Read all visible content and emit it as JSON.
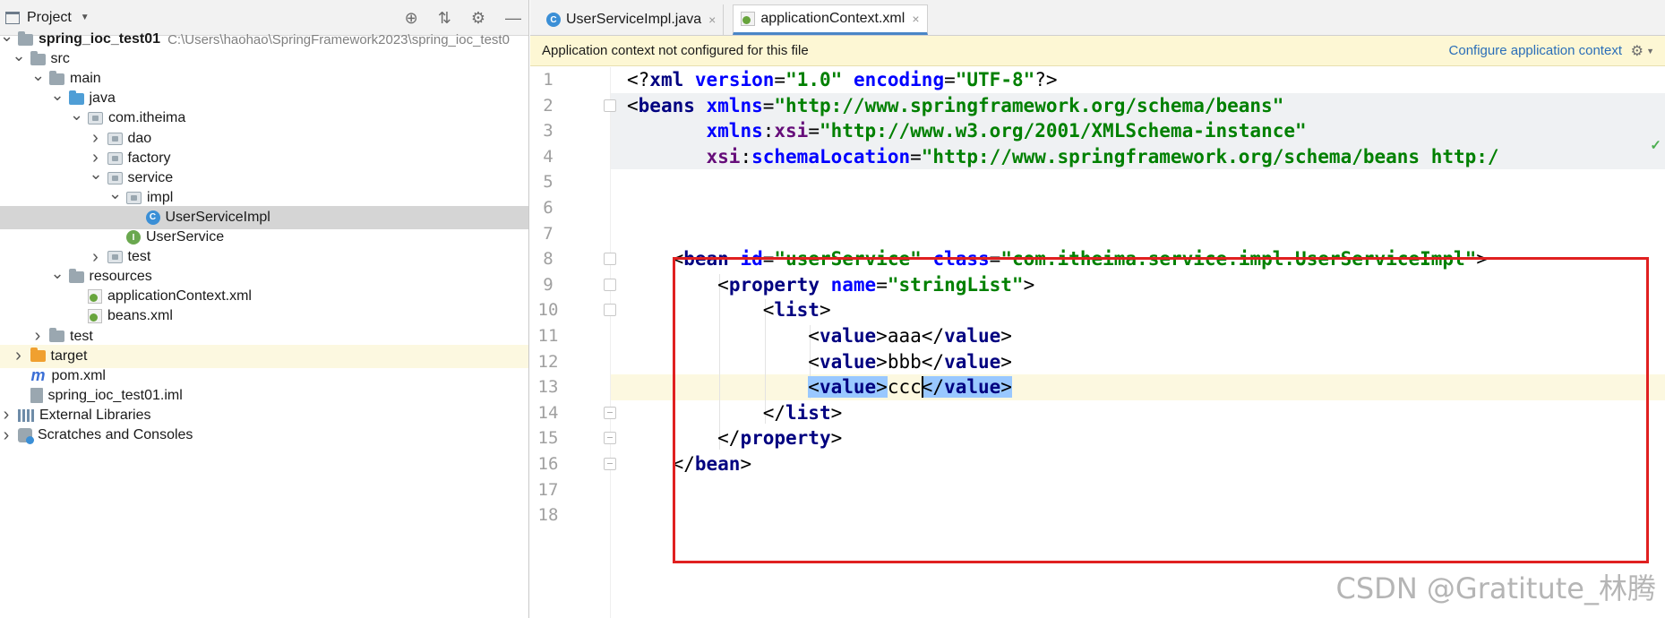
{
  "project_panel": {
    "title": "Project",
    "tools": [
      "target-icon",
      "collapse-icon",
      "gear-icon",
      "minimize-icon"
    ],
    "tree": [
      {
        "label": "spring_ioc_test01",
        "path": "C:\\Users\\haohao\\SpringFramework2023\\spring_ioc_test0",
        "depth": 0,
        "arrow": "v",
        "icon": "folder"
      },
      {
        "label": "src",
        "depth": 1,
        "arrow": "v",
        "icon": "folder"
      },
      {
        "label": "main",
        "depth": 2,
        "arrow": "v",
        "icon": "folder"
      },
      {
        "label": "java",
        "depth": 3,
        "arrow": "v",
        "icon": "folder-blue"
      },
      {
        "label": "com.itheima",
        "depth": 4,
        "arrow": "v",
        "icon": "package"
      },
      {
        "label": "dao",
        "depth": 5,
        "arrow": ">",
        "icon": "package"
      },
      {
        "label": "factory",
        "depth": 5,
        "arrow": ">",
        "icon": "package"
      },
      {
        "label": "service",
        "depth": 5,
        "arrow": "v",
        "icon": "package"
      },
      {
        "label": "impl",
        "depth": 6,
        "arrow": "v",
        "icon": "package"
      },
      {
        "label": "UserServiceImpl",
        "depth": 7,
        "arrow": "",
        "icon": "class"
      },
      {
        "label": "UserService",
        "depth": 6,
        "arrow": "",
        "icon": "interface"
      },
      {
        "label": "test",
        "depth": 5,
        "arrow": ">",
        "icon": "package"
      },
      {
        "label": "resources",
        "depth": 3,
        "arrow": "v",
        "icon": "folder-res"
      },
      {
        "label": "applicationContext.xml",
        "depth": 4,
        "arrow": "",
        "icon": "xml"
      },
      {
        "label": "beans.xml",
        "depth": 4,
        "arrow": "",
        "icon": "xml"
      },
      {
        "label": "test",
        "depth": 2,
        "arrow": ">",
        "icon": "folder"
      },
      {
        "label": "target",
        "depth": 1,
        "arrow": ">",
        "icon": "folder-orange"
      },
      {
        "label": "pom.xml",
        "depth": 1,
        "arrow": "",
        "icon": "maven"
      },
      {
        "label": "spring_ioc_test01.iml",
        "depth": 1,
        "arrow": "",
        "icon": "iml"
      },
      {
        "label": "External Libraries",
        "depth": 0,
        "arrow": ">",
        "icon": "library"
      },
      {
        "label": "Scratches and Consoles",
        "depth": 0,
        "arrow": ">",
        "icon": "scratch"
      }
    ],
    "selected_label": "UserServiceImpl"
  },
  "tabs": [
    {
      "label": "UserServiceImpl.java",
      "icon": "class-icon",
      "active": false
    },
    {
      "label": "applicationContext.xml",
      "icon": "xml-file-icon",
      "active": true
    }
  ],
  "notification": {
    "message": "Application context not configured for this file",
    "link": "Configure application context"
  },
  "editor": {
    "line_numbers": [
      "1",
      "2",
      "3",
      "4",
      "5",
      "6",
      "7",
      "8",
      "9",
      "10",
      "11",
      "12",
      "13",
      "14",
      "15",
      "16",
      "17",
      "18"
    ],
    "current_line": 13,
    "code": [
      [
        [
          "<?",
          "t-punct"
        ],
        [
          "xml",
          "t-tag"
        ],
        [
          " ",
          ""
        ],
        [
          "version",
          "t-attr"
        ],
        [
          "=",
          "t-punct"
        ],
        [
          "\"1.0\"",
          "t-str"
        ],
        [
          " ",
          ""
        ],
        [
          "encoding",
          "t-attr"
        ],
        [
          "=",
          "t-punct"
        ],
        [
          "\"UTF-8\"",
          "t-str"
        ],
        [
          "?>",
          "t-punct"
        ]
      ],
      [
        [
          "<",
          "t-punct"
        ],
        [
          "beans",
          "t-tag"
        ],
        [
          " ",
          ""
        ],
        [
          "xmlns",
          "t-attr"
        ],
        [
          "=",
          "t-punct"
        ],
        [
          "\"http://www.springframework.org/schema/beans\"",
          "t-str"
        ]
      ],
      [
        [
          "       ",
          ""
        ],
        [
          "xmlns",
          "t-attr"
        ],
        [
          ":",
          "t-punct"
        ],
        [
          "xsi",
          "t-ns"
        ],
        [
          "=",
          "t-punct"
        ],
        [
          "\"http://www.w3.org/2001/XMLSchema-instance\"",
          "t-str"
        ]
      ],
      [
        [
          "       ",
          ""
        ],
        [
          "xsi",
          "t-ns"
        ],
        [
          ":",
          "t-punct"
        ],
        [
          "schemaLocation",
          "t-attr"
        ],
        [
          "=",
          "t-punct"
        ],
        [
          "\"http://www.springframework.org/schema/beans http:/",
          "t-str"
        ]
      ],
      [],
      [],
      [],
      [
        [
          "    ",
          ""
        ],
        [
          "<",
          "t-punct"
        ],
        [
          "bean",
          "t-tag"
        ],
        [
          " ",
          ""
        ],
        [
          "id",
          "t-attr"
        ],
        [
          "=",
          "t-punct"
        ],
        [
          "\"userService\"",
          "t-str"
        ],
        [
          " ",
          ""
        ],
        [
          "class",
          "t-attr"
        ],
        [
          "=",
          "t-punct"
        ],
        [
          "\"com.itheima.service.impl.UserServiceImpl\"",
          "t-str"
        ],
        [
          ">",
          "t-punct"
        ]
      ],
      [
        [
          "        ",
          ""
        ],
        [
          "<",
          "t-punct"
        ],
        [
          "property",
          "t-tag"
        ],
        [
          " ",
          ""
        ],
        [
          "name",
          "t-attr"
        ],
        [
          "=",
          "t-punct"
        ],
        [
          "\"stringList\"",
          "t-str"
        ],
        [
          ">",
          "t-punct"
        ]
      ],
      [
        [
          "            ",
          ""
        ],
        [
          "<",
          "t-punct"
        ],
        [
          "list",
          "t-tag"
        ],
        [
          ">",
          "t-punct"
        ]
      ],
      [
        [
          "                ",
          ""
        ],
        [
          "<",
          "t-punct"
        ],
        [
          "value",
          "t-tag"
        ],
        [
          ">",
          "t-punct"
        ],
        [
          "aaa",
          "t-text"
        ],
        [
          "</",
          "t-punct"
        ],
        [
          "value",
          "t-tag"
        ],
        [
          ">",
          "t-punct"
        ]
      ],
      [
        [
          "                ",
          ""
        ],
        [
          "<",
          "t-punct"
        ],
        [
          "value",
          "t-tag"
        ],
        [
          ">",
          "t-punct"
        ],
        [
          "bbb",
          "t-text"
        ],
        [
          "</",
          "t-punct"
        ],
        [
          "value",
          "t-tag"
        ],
        [
          ">",
          "t-punct"
        ]
      ],
      [
        [
          "                ",
          ""
        ],
        [
          "<",
          "t-punct sel-hl"
        ],
        [
          "value",
          "t-tag sel-hl"
        ],
        [
          ">",
          "t-punct sel-hl"
        ],
        [
          "ccc",
          "t-text"
        ],
        [
          "</",
          "t-punct sel-hl"
        ],
        [
          "value",
          "t-tag sel-hl"
        ],
        [
          ">",
          "t-punct sel-hl"
        ]
      ],
      [
        [
          "            ",
          ""
        ],
        [
          "</",
          "t-punct"
        ],
        [
          "list",
          "t-tag"
        ],
        [
          ">",
          "t-punct"
        ]
      ],
      [
        [
          "        ",
          ""
        ],
        [
          "</",
          "t-punct"
        ],
        [
          "property",
          "t-tag"
        ],
        [
          ">",
          "t-punct"
        ]
      ],
      [
        [
          "    ",
          ""
        ],
        [
          "</",
          "t-punct"
        ],
        [
          "bean",
          "t-tag"
        ],
        [
          ">",
          "t-punct"
        ]
      ],
      [],
      []
    ]
  },
  "watermark": "CSDN @Gratitute_林腾",
  "colors": {
    "accent": "#4a86c7",
    "notification_bg": "#fdf7d4",
    "link": "#2a6eb8",
    "annotation_box": "#e02020",
    "xml_tag": "#000080",
    "xml_attr": "#0000ff",
    "xml_string": "#008000"
  }
}
